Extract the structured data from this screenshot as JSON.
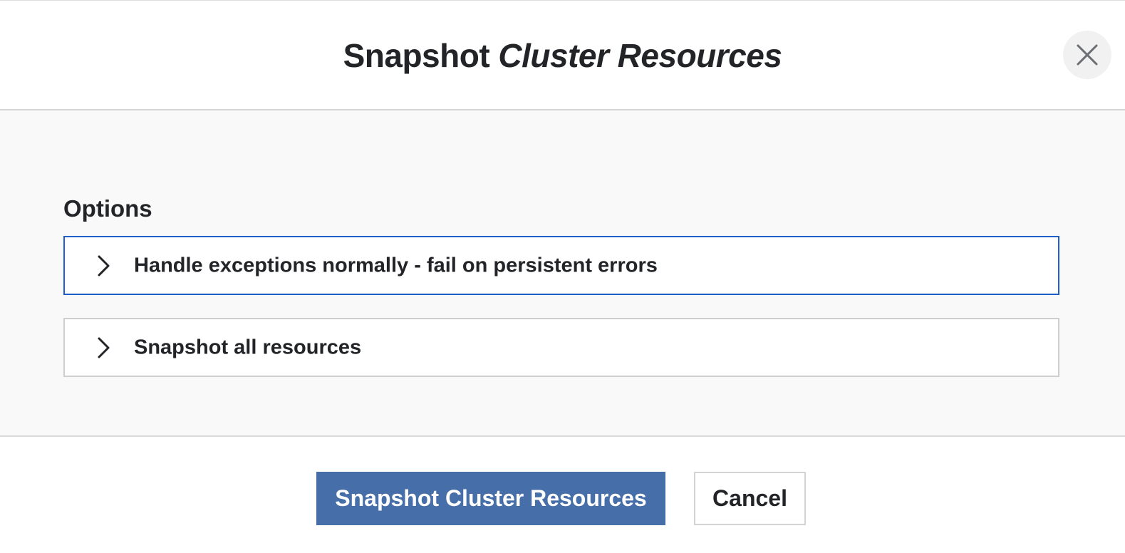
{
  "dialog": {
    "title_prefix": "Snapshot",
    "title_emphasis": "Cluster Resources",
    "close_icon": "close-icon"
  },
  "options_section": {
    "label": "Options",
    "items": [
      {
        "label": "Handle exceptions normally - fail on persistent errors",
        "icon": "chevron-right-icon",
        "focused": true
      },
      {
        "label": "Snapshot all resources",
        "icon": "chevron-right-icon",
        "focused": false
      }
    ]
  },
  "footer": {
    "primary_label": "Snapshot Cluster Resources",
    "cancel_label": "Cancel"
  },
  "colors": {
    "primary_button": "#466ea8",
    "focus_border": "#1f5fc9",
    "body_background": "#f9f9f9",
    "text": "#222428"
  }
}
